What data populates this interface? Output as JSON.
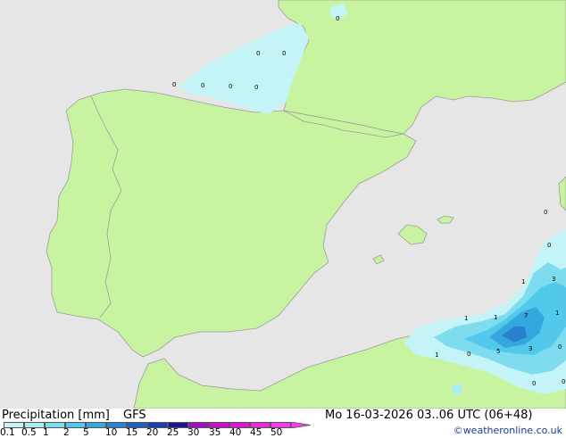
{
  "title": "Precipitation [mm]",
  "model": "GFS",
  "datetime": "Mo 16-03-2026 03..06 UTC (06+48)",
  "credit": "©weatheronline.co.uk",
  "legend": {
    "ticks": [
      "0.1",
      "0.5",
      "1",
      "2",
      "5",
      "10",
      "15",
      "20",
      "25",
      "30",
      "35",
      "40",
      "45",
      "50"
    ],
    "colors": [
      "#c4f4f8",
      "#a6eef5",
      "#7edcef",
      "#52c8eb",
      "#34a8de",
      "#2882cf",
      "#1f5ec3",
      "#1c3fb0",
      "#17169a",
      "#9d0fc4",
      "#c80fcf",
      "#df14d4",
      "#ea29dc",
      "#f53bea"
    ]
  },
  "colors": {
    "sea": "#e6e6e6",
    "land": "#c8f4a2",
    "border": "#9c9c9c"
  },
  "precip_labels": [
    "0",
    "0",
    "0",
    "0",
    "0",
    "0",
    "0",
    "0",
    "0",
    "1",
    "3",
    "1",
    "1",
    "7",
    "1",
    "1",
    "0",
    "5",
    "3",
    "0",
    "0",
    "0"
  ]
}
